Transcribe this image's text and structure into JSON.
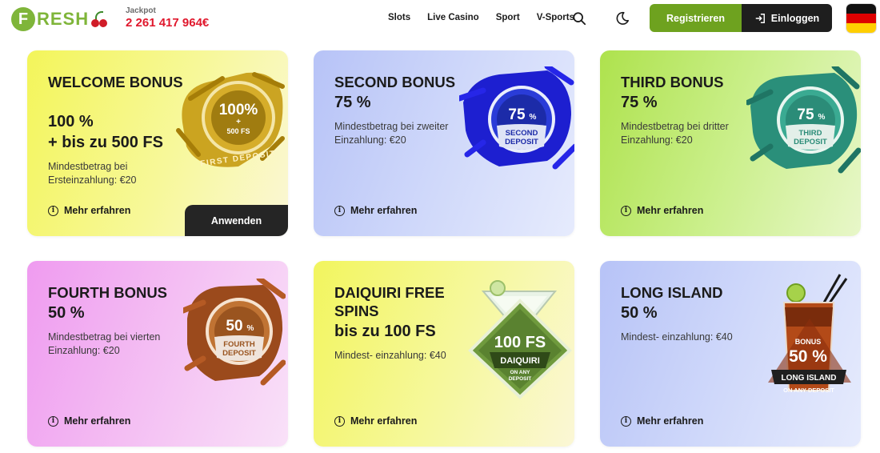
{
  "brand": {
    "logo_letter": "F",
    "logo_rest": "RESH"
  },
  "jackpot": {
    "label": "Jackpot",
    "value": "2 261 417 964€"
  },
  "nav": [
    "Slots",
    "Live Casino",
    "Sport",
    "V-Sports"
  ],
  "auth": {
    "register": "Registrieren",
    "login": "Einloggen"
  },
  "colors": {
    "accent_green": "#6ea21f",
    "jackpot_red": "#e0182d",
    "dark": "#1e1e1e"
  },
  "cards": [
    {
      "title": "WELCOME BONUS",
      "amount_line1": "100 %",
      "amount_line2": "+ bis zu 500 FS",
      "desc": "Mindestbetrag bei Ersteinzahlung: €20",
      "more": "Mehr erfahren",
      "apply": "Anwenden",
      "badge": {
        "big": "100%",
        "mid": "+",
        "small": "500 FS",
        "ring": "FIRST DEPOSIT"
      }
    },
    {
      "title": "SECOND BONUS",
      "amount_line1": "75 %",
      "desc": "Mindestbetrag bei zweiter Einzahlung: €20",
      "more": "Mehr erfahren",
      "badge": {
        "big": "75",
        "pct": "%",
        "line1": "SECOND",
        "line2": "DEPOSIT"
      }
    },
    {
      "title": "THIRD BONUS",
      "amount_line1": "75 %",
      "desc": "Mindestbetrag bei dritter Einzahlung: €20",
      "more": "Mehr erfahren",
      "badge": {
        "big": "75",
        "pct": "%",
        "line1": "THIRD",
        "line2": "DEPOSIT"
      }
    },
    {
      "title": "FOURTH BONUS",
      "amount_line1": "50 %",
      "desc": "Mindestbetrag bei vierten Einzahlung: €20",
      "more": "Mehr erfahren",
      "badge": {
        "big": "50",
        "pct": "%",
        "line1": "FOURTH",
        "line2": "DEPOSIT"
      }
    },
    {
      "title": "DAIQUIRI FREE SPINS",
      "amount_line1": "bis zu 100 FS",
      "desc": "Mindest- einzahlung: €40",
      "more": "Mehr erfahren",
      "badge": {
        "big": "100 FS",
        "line1": "DAIQUIRI",
        "line2": "ON ANY",
        "line3": "DEPOSIT"
      }
    },
    {
      "title": "LONG ISLAND",
      "amount_line1": "50 %",
      "desc": "Mindest- einzahlung: €40",
      "more": "Mehr erfahren",
      "badge": {
        "small": "BONUS",
        "big": "50 %",
        "line1": "LONG ISLAND",
        "line2": "ON ANY DEPOSIT"
      }
    }
  ]
}
